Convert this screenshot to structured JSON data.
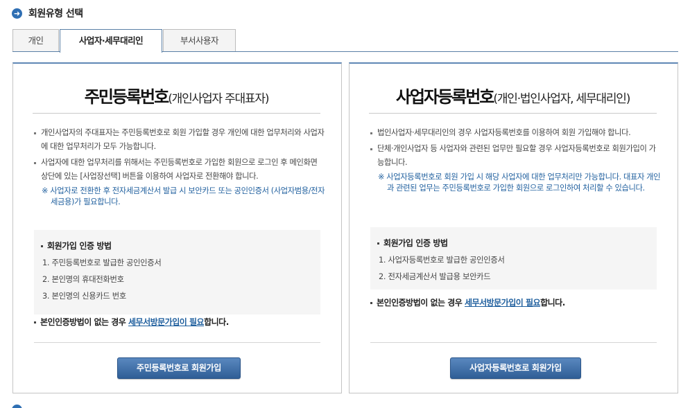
{
  "section": {
    "title": "회원유형 선택",
    "icon": "arrow-right-circle-icon"
  },
  "tabs": [
    {
      "label": "개인",
      "active": false
    },
    {
      "label": "사업자·세무대리인",
      "active": true
    },
    {
      "label": "부서사용자",
      "active": false
    }
  ],
  "left": {
    "heading_main": "주민등록번호",
    "heading_sub": "(개인사업자 주대표자)",
    "bullet1": "개인사업자의 주대표자는 주민등록번호로 회원 가입할 경우 개인에 대한 업무처리와 사업자에 대한 업무처리가 모두 가능합니다.",
    "bullet2": "사업자에 대한 업무처리를 위해서는 주민등록번호로 가입한 회원으로 로그인 후 메인화면 상단에 있는 [사업장선택] 버튼을 이용하여 사업자로 전환해야 합니다.",
    "note": "※ 사업자로 전환한 후 전자세금계산서 발급 시 보안카드 또는 공인인증서 (사업자범용/전자세금용)가 필요합니다.",
    "method_title": "회원가입 인증 방법",
    "methods": [
      "1. 주민등록번호로 발급한 공인인증서",
      "2. 본인명의 휴대전화번호",
      "3. 본인명의 신용카드 번호"
    ],
    "no_method_prefix": "본인인증방법이 없는 경우 ",
    "no_method_link": "세무서방문가입이 필요",
    "no_method_suffix": "합니다.",
    "button": "주민등록번호로 회원가입"
  },
  "right": {
    "heading_main": "사업자등록번호",
    "heading_sub": "(개인·법인사업자, 세무대리인)",
    "bullet1": "법인사업자·세무대리인의 경우 사업자등록번호를 이용하여 회원 가입해야 합니다.",
    "bullet2": "단체·개인사업자 등 사업자와 관련된 업무만 필요할 경우 사업자등록번호로 회원가입이 가능합니다.",
    "note": "※ 사업자등록번호로 회원 가입 시 해당 사업자에 대한 업무처리만 가능합니다. 대표자 개인과 관련된 업무는 주민등록번호로 가입한 회원으로 로그인하여 처리할 수 있습니다.",
    "method_title": "회원가입 인증 방법",
    "methods": [
      "1. 사업자등록번호로 발급한 공인인증서",
      "2. 전자세금계산서 발급용 보안카드"
    ],
    "no_method_prefix": "본인인증방법이 없는 경우 ",
    "no_method_link": "세무서방문가입이 필요",
    "no_method_suffix": "합니다.",
    "button": "사업자등록번호로 회원가입"
  }
}
